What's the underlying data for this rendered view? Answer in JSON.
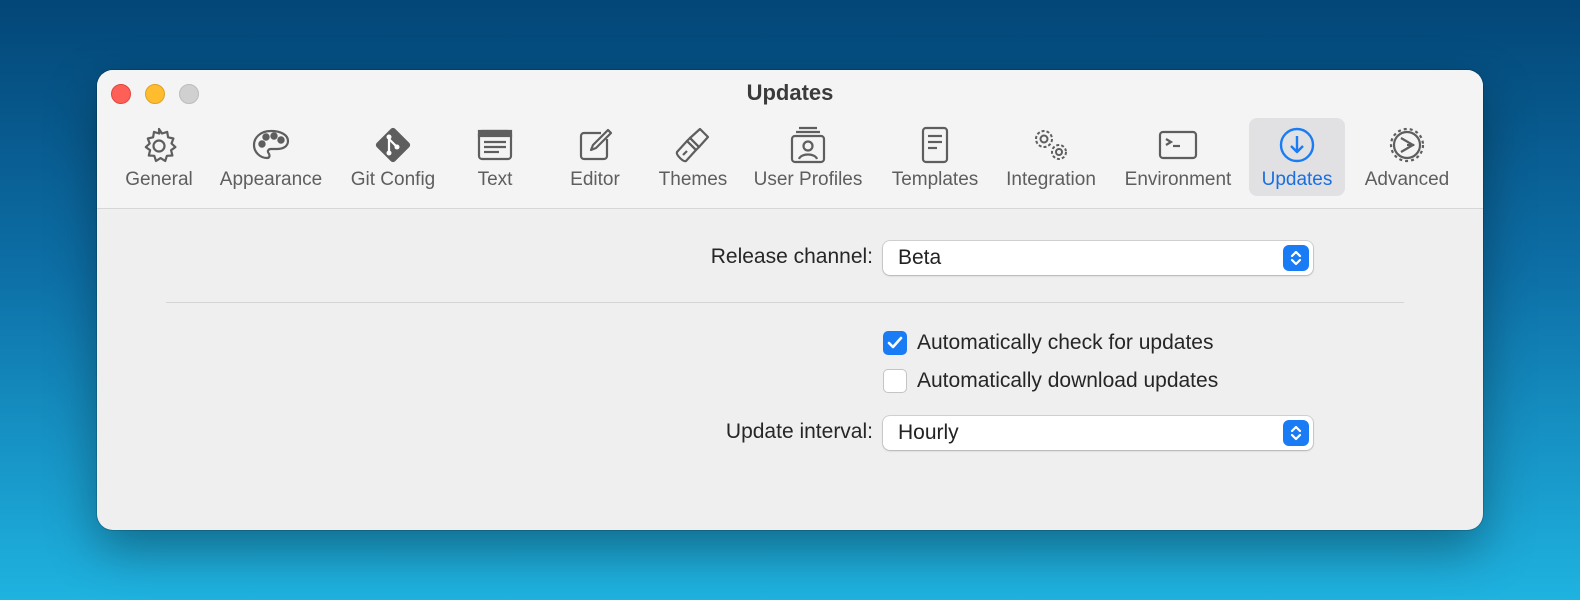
{
  "window": {
    "title": "Updates"
  },
  "toolbar": {
    "tabs": [
      {
        "label": "General",
        "icon": "gear-icon"
      },
      {
        "label": "Appearance",
        "icon": "palette-icon"
      },
      {
        "label": "Git Config",
        "icon": "git-icon"
      },
      {
        "label": "Text",
        "icon": "text-icon"
      },
      {
        "label": "Editor",
        "icon": "editor-icon"
      },
      {
        "label": "Themes",
        "icon": "brush-icon"
      },
      {
        "label": "User Profiles",
        "icon": "user-profiles-icon"
      },
      {
        "label": "Templates",
        "icon": "template-icon"
      },
      {
        "label": "Integration",
        "icon": "gears-icon"
      },
      {
        "label": "Environment",
        "icon": "terminal-icon"
      },
      {
        "label": "Updates",
        "icon": "download-circle-icon",
        "active": true
      },
      {
        "label": "Advanced",
        "icon": "advanced-gear-icon"
      }
    ]
  },
  "settings": {
    "release_channel": {
      "label": "Release channel:",
      "value": "Beta"
    },
    "auto_check": {
      "label": "Automatically check for updates",
      "checked": true
    },
    "auto_download": {
      "label": "Automatically download updates",
      "checked": false
    },
    "update_interval": {
      "label": "Update interval:",
      "value": "Hourly"
    }
  },
  "colors": {
    "accent": "#1a7cf4",
    "active_label": "#1a6fe0",
    "close": "#fe5f57",
    "minimize": "#febc2e"
  }
}
